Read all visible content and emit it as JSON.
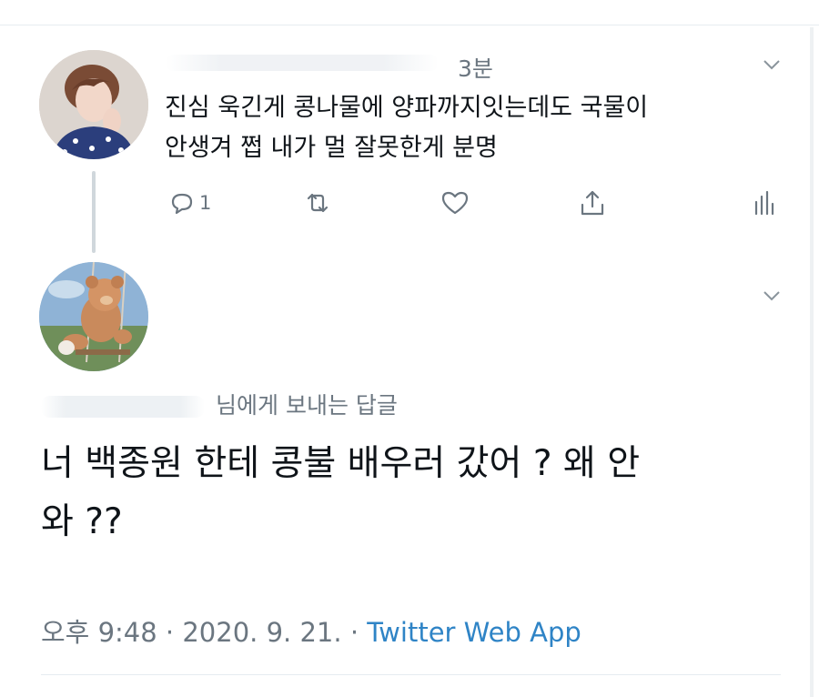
{
  "parent_tweet": {
    "time_ago": "3분",
    "text": "진심 욱긴게 콩나물에 양파까지잇는데도 국물이\n안생겨 쩝 내가 멀 잘못한게 분명",
    "reply_count": "1"
  },
  "main_tweet": {
    "reply_to_suffix": "님에게 보내는 답글",
    "text": "너 백종원 한테 콩불 배우러 갔어 ? 왜 안\n와 ??",
    "time": "오후 9:48",
    "date": "2020. 9. 21.",
    "separator": "·",
    "source_app": "Twitter Web App"
  },
  "colors": {
    "text_primary": "#0f1419",
    "text_secondary": "#6b7680",
    "link": "#2f84c6",
    "divider": "#e6ecf0"
  },
  "icons": [
    "chevron-down-icon",
    "reply-icon",
    "retweet-icon",
    "like-icon",
    "share-icon",
    "analytics-icon"
  ]
}
